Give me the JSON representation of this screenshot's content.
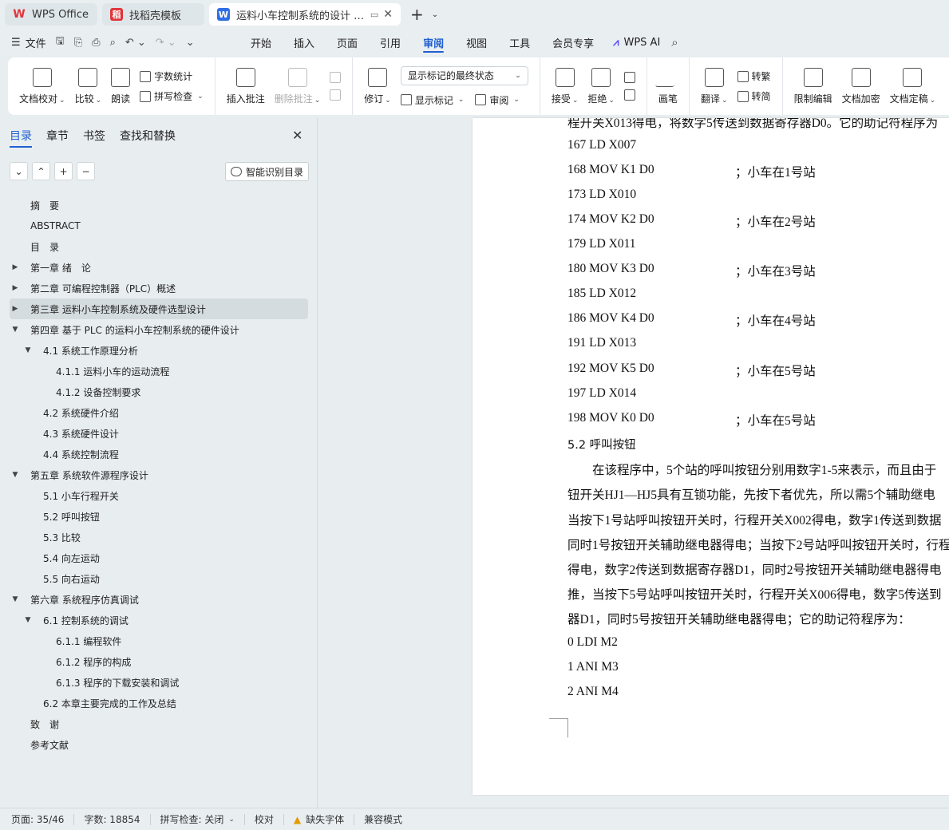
{
  "tabs": [
    {
      "title": "WPS Office",
      "icon": "wps-logo-icon",
      "color": "#e0353b"
    },
    {
      "title": "找稻壳模板",
      "icon": "daoke-icon",
      "color": "#e0353b"
    },
    {
      "title": "运料小车控制系统的设计 毕业",
      "icon": "word-doc-icon",
      "color": "#2f6fe4"
    }
  ],
  "menubar": {
    "file_label": "文件",
    "tabs": [
      "开始",
      "插入",
      "页面",
      "引用",
      "审阅",
      "视图",
      "工具",
      "会员专享"
    ],
    "active_tab": "审阅",
    "ai_label": "WPS AI"
  },
  "ribbon": {
    "doc_check": "文档校对",
    "compare": "比较",
    "read_aloud": "朗读",
    "word_count": "字数统计",
    "spell_check": "拼写检查",
    "insert_comment": "插入批注",
    "delete_comment": "删除批注",
    "revise": "修订",
    "markup_dropdown": "显示标记的最终状态",
    "show_markup": "显示标记",
    "review_pane": "审阅",
    "accept": "接受",
    "reject": "拒绝",
    "pen": "画笔",
    "translate": "翻译",
    "to_traditional": "转繁",
    "to_simplified": "转简",
    "restrict_edit": "限制编辑",
    "encrypt": "文档加密",
    "finalize": "文档定稿"
  },
  "nav": {
    "tabs": [
      "目录",
      "章节",
      "书签",
      "查找和替换"
    ],
    "active_tab": "目录",
    "smart_toc": "智能识别目录",
    "items": [
      {
        "label": "摘　要",
        "level": 0,
        "arrow": ""
      },
      {
        "label": "ABSTRACT",
        "level": 0,
        "arrow": ""
      },
      {
        "label": "目　录",
        "level": 0,
        "arrow": ""
      },
      {
        "label": "第一章  绪　论",
        "level": 0,
        "arrow": "▶"
      },
      {
        "label": "第二章  可编程控制器（PLC）概述",
        "level": 0,
        "arrow": "▶"
      },
      {
        "label": "第三章  运料小车控制系统及硬件选型设计",
        "level": 0,
        "arrow": "▶",
        "selected": true
      },
      {
        "label": "第四章  基于 PLC 的运料小车控制系统的硬件设计",
        "level": 0,
        "arrow": "▼"
      },
      {
        "label": "4.1  系统工作原理分析",
        "level": 1,
        "arrow": "▼"
      },
      {
        "label": "4.1.1  运料小车的运动流程",
        "level": 2,
        "arrow": ""
      },
      {
        "label": "4.1.2 设备控制要求",
        "level": 2,
        "arrow": ""
      },
      {
        "label": "4.2  系统硬件介绍",
        "level": 1,
        "arrow": ""
      },
      {
        "label": "4.3  系统硬件设计",
        "level": 1,
        "arrow": ""
      },
      {
        "label": "4.4  系统控制流程",
        "level": 1,
        "arrow": ""
      },
      {
        "label": "第五章  系统软件源程序设计",
        "level": 0,
        "arrow": "▼"
      },
      {
        "label": "5.1  小车行程开关",
        "level": 1,
        "arrow": ""
      },
      {
        "label": "5.2  呼叫按钮",
        "level": 1,
        "arrow": ""
      },
      {
        "label": "5.3  比较",
        "level": 1,
        "arrow": ""
      },
      {
        "label": "5.4  向左运动",
        "level": 1,
        "arrow": ""
      },
      {
        "label": "5.5  向右运动",
        "level": 1,
        "arrow": ""
      },
      {
        "label": "第六章  系统程序仿真调试",
        "level": 0,
        "arrow": "▼"
      },
      {
        "label": "6.1  控制系统的调试",
        "level": 1,
        "arrow": "▼"
      },
      {
        "label": "6.1.1 编程软件",
        "level": 2,
        "arrow": ""
      },
      {
        "label": "6.1.2  程序的构成",
        "level": 2,
        "arrow": ""
      },
      {
        "label": "6.1.3  程序的下载安装和调试",
        "level": 2,
        "arrow": ""
      },
      {
        "label": "6.2  本章主要完成的工作及总结",
        "level": 1,
        "arrow": ""
      },
      {
        "label": "致　谢",
        "level": 0,
        "arrow": ""
      },
      {
        "label": "参考文献",
        "level": 0,
        "arrow": ""
      }
    ]
  },
  "document": {
    "lines": [
      {
        "text": "程开关X013得电，将数字5传送到数据寄存器D0。它的助记符程序为",
        "comment": ""
      },
      {
        "text": "167 LD X007",
        "comment": ""
      },
      {
        "text": "168 MOV K1 D0",
        "comment": "；小车在1号站"
      },
      {
        "text": "173 LD X010",
        "comment": ""
      },
      {
        "text": "174 MOV K2 D0",
        "comment": "；小车在2号站"
      },
      {
        "text": "179 LD X011",
        "comment": ""
      },
      {
        "text": "180 MOV K3 D0",
        "comment": "；小车在3号站"
      },
      {
        "text": "185 LD X012",
        "comment": ""
      },
      {
        "text": "186 MOV K4 D0",
        "comment": "；小车在4号站"
      },
      {
        "text": "191 LD X013",
        "comment": ""
      },
      {
        "text": "192 MOV K5 D0",
        "comment": "；小车在5号站"
      },
      {
        "text": "197 LD X014",
        "comment": ""
      },
      {
        "text": "198 MOV K0 D0",
        "comment": "；小车在5号站"
      },
      {
        "text": "5.2  呼叫按钮",
        "comment": ""
      },
      {
        "text": "　　在该程序中，5个站的呼叫按钮分别用数字1-5来表示，而且由于",
        "comment": ""
      },
      {
        "text": "钮开关HJ1—HJ5具有互锁功能，先按下者优先，所以需5个辅助继电",
        "comment": ""
      },
      {
        "text": "当按下1号站呼叫按钮开关时，行程开关X002得电，数字1传送到数据",
        "comment": ""
      },
      {
        "text": "同时1号按钮开关辅助继电器得电；当按下2号站呼叫按钮开关时，行程",
        "comment": ""
      },
      {
        "text": "得电，数字2传送到数据寄存器D1，同时2号按钮开关辅助继电器得电",
        "comment": ""
      },
      {
        "text": "推，当按下5号站呼叫按钮开关时，行程开关X006得电，数字5传送到",
        "comment": ""
      },
      {
        "text": "器D1，同时5号按钮开关辅助继电器得电；它的助记符程序为：",
        "comment": ""
      },
      {
        "text": "0 LDI M2",
        "comment": ""
      },
      {
        "text": "1 ANI M3",
        "comment": ""
      },
      {
        "text": "2 ANI M4",
        "comment": ""
      }
    ]
  },
  "status": {
    "page": "页面: 35/46",
    "words": "字数: 18854",
    "spell": "拼写检查: 关闭",
    "proof": "校对",
    "missing_font": "缺失字体",
    "compat": "兼容模式"
  }
}
